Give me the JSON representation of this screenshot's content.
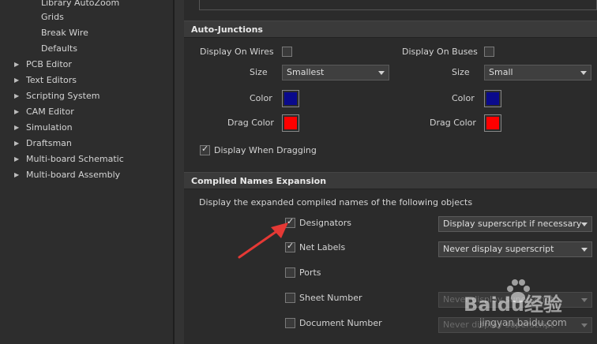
{
  "tree": {
    "subitems": [
      "Library AutoZoom",
      "Grids",
      "Break Wire",
      "Defaults"
    ],
    "items": [
      "PCB Editor",
      "Text Editors",
      "Scripting System",
      "CAM Editor",
      "Simulation",
      "Draftsman",
      "Multi-board Schematic",
      "Multi-board Assembly"
    ]
  },
  "auto_junctions": {
    "header": "Auto-Junctions",
    "wires": {
      "display_label": "Display On Wires",
      "display_checked": false,
      "size_label": "Size",
      "size_value": "Smallest",
      "color_label": "Color",
      "color": "#0a0a8c",
      "drag_color_label": "Drag Color",
      "drag_color": "#ff0000"
    },
    "buses": {
      "display_label": "Display On Buses",
      "display_checked": false,
      "size_label": "Size",
      "size_value": "Small",
      "color_label": "Color",
      "color": "#0a0a8c",
      "drag_color_label": "Drag Color",
      "drag_color": "#ff0000"
    },
    "dragging_label": "Display When Dragging",
    "dragging_checked": true
  },
  "compiled_names": {
    "header": "Compiled Names Expansion",
    "description": "Display the expanded compiled names of the following objects",
    "rows": [
      {
        "label": "Designators",
        "checked": true,
        "option": "Display superscript if necessary",
        "enabled": true
      },
      {
        "label": "Net Labels",
        "checked": true,
        "option": "Never display superscript",
        "enabled": true
      },
      {
        "label": "Ports",
        "checked": false,
        "option": "",
        "enabled": false
      },
      {
        "label": "Sheet Number",
        "checked": false,
        "option": "Never display superscript",
        "enabled": false
      },
      {
        "label": "Document Number",
        "checked": false,
        "option": "Never display superscript",
        "enabled": false
      }
    ]
  },
  "watermark": {
    "brand": "Baidu经验",
    "url": "jingyan.baidu.com"
  },
  "annotation": {
    "color": "#e53935"
  }
}
